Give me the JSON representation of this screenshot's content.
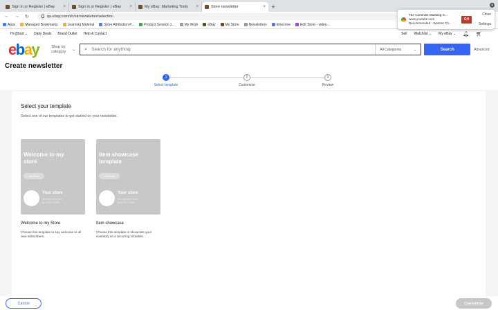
{
  "browser": {
    "tabs": [
      {
        "title": "Sign in or Register | eBay",
        "favicon_color": "#6b4f2a",
        "active": false
      },
      {
        "title": "Sign in or Register | eBay",
        "favicon_color": "#6b4f2a",
        "active": false
      },
      {
        "title": "My eBay: Marketing Tools",
        "favicon_color": "#6b4f2a",
        "active": false
      },
      {
        "title": "Store newsletter",
        "favicon_color": "#6b4f2a",
        "active": true
      }
    ],
    "url": "qa.ebay.com/sh/str/newsletter/selection",
    "bookmarks": [
      {
        "label": "Apps",
        "color": "#4285f4"
      },
      {
        "label": "Managed Bookmarks",
        "color": "#f5b400"
      },
      {
        "label": "Learning Material",
        "color": "#f5b400"
      },
      {
        "label": "Store Attribution P...",
        "color": "#4285f4"
      },
      {
        "label": "Product Session z...",
        "color": "#34a853"
      },
      {
        "label": "My Work",
        "color": "#999999"
      },
      {
        "label": "eBay",
        "color": "#6b4f2a"
      },
      {
        "label": "My Store",
        "color": "#6b4f2a"
      },
      {
        "label": "Newsletters",
        "color": "#999999"
      },
      {
        "label": "timezone",
        "color": "#4285f4"
      },
      {
        "label": "Edit Store - video...",
        "color": "#a142f4"
      }
    ]
  },
  "popup": {
    "title": "The Cummins Mustang S...",
    "site": "www.youtube.com",
    "status": "Recommended · Weston Ch...",
    "close_label": "Close",
    "settings_label": "Settings",
    "thumb_text": "GH"
  },
  "ebay_header": {
    "greeting": "Hi @bud",
    "daily_deals": "Daily Deals",
    "brand_outlet": "Brand Outlet",
    "help": "Help & Contact",
    "sell": "Sell",
    "watchlist": "Watchlist",
    "my_ebay": "My eBay",
    "logo_letters": [
      "e",
      "b",
      "a",
      "y"
    ],
    "shop_by": "Shop by category",
    "search_placeholder": "Search for anything",
    "categories": "All Categories",
    "search_button": "Search",
    "advanced": "Advanced"
  },
  "page": {
    "title": "Create newsletter"
  },
  "stepper": {
    "steps": [
      {
        "number": "1",
        "label": "Select template",
        "active": true
      },
      {
        "number": "2",
        "label": "Customize",
        "active": false
      },
      {
        "number": "3",
        "label": "Review",
        "active": false
      }
    ]
  },
  "content": {
    "section_title": "Select your template",
    "section_subtitle": "Select one of our templates to get started on your newsletter.",
    "templates": [
      {
        "preview_heading": "Welcome to my store",
        "visit_label": "Visit Store",
        "store_name": "Your store",
        "store_meta_1": "On eBay since xx/xx",
        "store_meta_2": "xx,XX,XXX 100%",
        "name": "Welcome to my Store",
        "description": "Choose this template to say welcome to all new subscribers."
      },
      {
        "preview_heading": "Item showcase template",
        "visit_label": "Visit Store",
        "store_name": "Your store",
        "store_meta_1": "On eBay since xx/xx",
        "store_meta_2": "xx,XX,XXX 100%",
        "name": "Item showcase",
        "description": "Choose this template to showcase your inventory on a recurring schedule."
      }
    ]
  },
  "footer": {
    "cancel": "Cancel",
    "customize": "Customize"
  },
  "colors": {
    "accent": "#3665f3",
    "template_gray": "#c8c8c8",
    "disabled": "#c7c7c7"
  }
}
